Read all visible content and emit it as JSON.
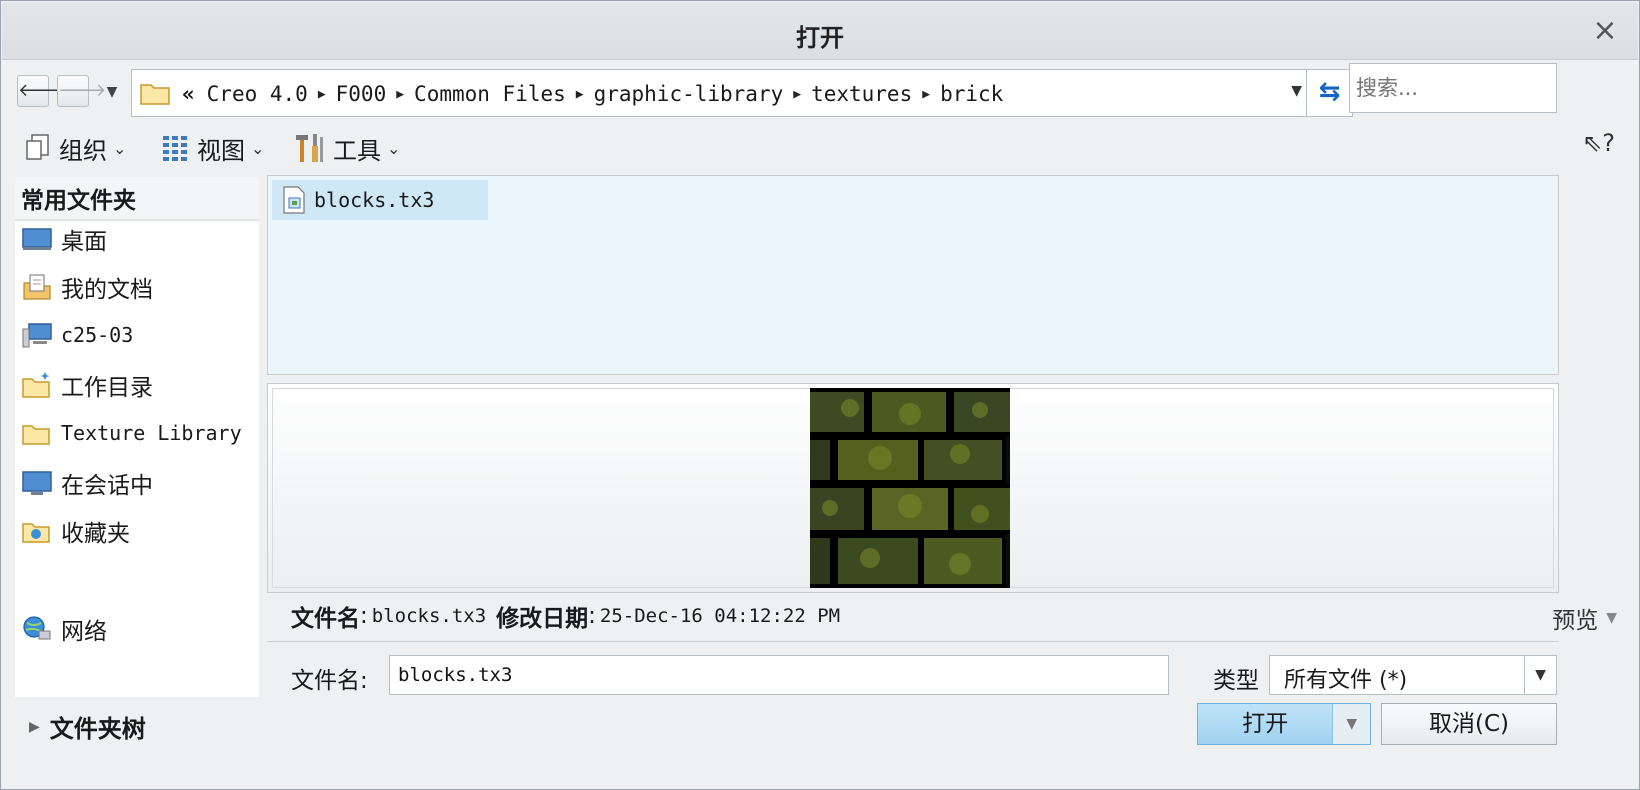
{
  "window": {
    "title": "打开",
    "close_icon": "close-icon"
  },
  "nav": {
    "back_icon": "back-arrow-icon",
    "forward_icon": "forward-arrow-icon",
    "recent_dropdown_icon": "chevron-down-icon",
    "path_overflow": "«",
    "breadcrumbs": [
      "Creo 4.0",
      "F000",
      "Common Files",
      "graphic-library",
      "textures",
      "brick"
    ],
    "refresh_icon": "refresh-icon",
    "search_placeholder": "搜索..."
  },
  "toolbar": {
    "organize_label": "组织",
    "view_label": "视图",
    "tools_label": "工具",
    "help_icon": "whats-this-help-icon"
  },
  "sidebar": {
    "header": "常用文件夹",
    "items": [
      {
        "label": "桌面",
        "icon": "desktop-icon"
      },
      {
        "label": "我的文档",
        "icon": "documents-icon"
      },
      {
        "label": "c25-03",
        "icon": "computer-icon"
      },
      {
        "label": "工作目录",
        "icon": "working-directory-icon"
      },
      {
        "label": "Texture Library",
        "icon": "folder-icon"
      },
      {
        "label": "在会话中",
        "icon": "session-icon"
      },
      {
        "label": "收藏夹",
        "icon": "favorites-icon"
      },
      {
        "label": "网络",
        "icon": "network-icon"
      }
    ]
  },
  "files": [
    {
      "name": "blocks.tx3",
      "icon": "texture-file-icon",
      "selected": true
    }
  ],
  "preview": {
    "image": "green-moss-stone-brick-texture"
  },
  "info": {
    "filename_key": "文件名",
    "filename_value": "blocks.tx3",
    "modified_key": "修改日期",
    "modified_value": "25-Dec-16 04:12:22 PM",
    "preview_toggle": "预览"
  },
  "form": {
    "filename_label": "文件名:",
    "filename_value": "blocks.tx3",
    "type_label": "类型",
    "type_value": "所有文件 (*)"
  },
  "footer": {
    "folder_tree_label": "文件夹树",
    "open_label": "打开",
    "cancel_label": "取消(C)"
  },
  "colors": {
    "selection": "#cfe8f6",
    "list_background": "#eaf6fc",
    "primary_button": "#a9d8f2",
    "refresh_accent": "#1565c0"
  }
}
